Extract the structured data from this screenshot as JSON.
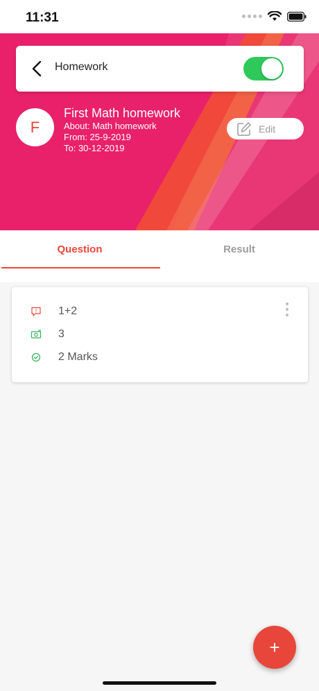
{
  "status_bar": {
    "time": "11:31",
    "icons": [
      "signal-dots-icon",
      "wifi-icon",
      "battery-icon"
    ]
  },
  "header": {
    "title": "Homework",
    "toggle_on": true,
    "accent": "#e8216a",
    "avatar_initial": "F",
    "homework_title": "First Math homework",
    "about": "About: Math homework",
    "from": "From: 25-9-2019",
    "to": "To: 30-12-2019",
    "edit_label": "Edit"
  },
  "tabs": [
    {
      "label": "Question",
      "active": true
    },
    {
      "label": "Result",
      "active": false
    }
  ],
  "question_card": {
    "rows": [
      {
        "icon": "question-bubble-icon",
        "text": "1+2",
        "color": "#e8463a"
      },
      {
        "icon": "answer-icon",
        "text": "3",
        "color": "#2fb35a"
      },
      {
        "icon": "check-circle-icon",
        "text": "2 Marks",
        "color": "#2fb35a"
      }
    ]
  },
  "fab_label": "+",
  "colors": {
    "primary": "#e8463a",
    "toggle": "#2fc85b"
  }
}
